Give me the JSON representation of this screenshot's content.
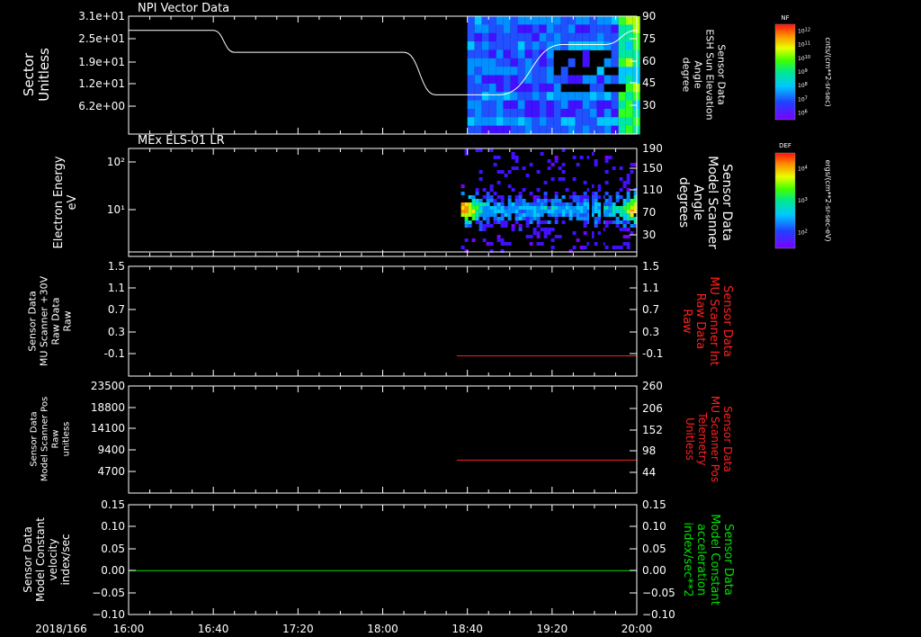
{
  "xaxis": {
    "date_label": "2018/166",
    "ticks": [
      "16:00",
      "16:40",
      "17:20",
      "18:00",
      "18:40",
      "19:20",
      "20:00"
    ]
  },
  "colors": {
    "background": "#000000",
    "axes": "#ffffff",
    "red": "#ff2020",
    "green": "#00e000"
  },
  "chart_data": [
    {
      "type": "heatmap",
      "title": "NPI Vector Data",
      "ylabel_left": [
        "Sector",
        "Unitless"
      ],
      "yticks_left": [
        "3.1e+01",
        "2.5e+01",
        "1.9e+01",
        "1.2e+01",
        "6.2e+00"
      ],
      "ylabel_right": [
        "Sensor Data",
        "ESH Sun Elevation",
        "Angle",
        "degree"
      ],
      "yticks_right": [
        "90",
        "75",
        "60",
        "45",
        "30"
      ],
      "ylim_right": [
        15,
        90
      ],
      "line_series": {
        "name": "ESH Sun Elevation",
        "x": [
          "16:00",
          "16:40",
          "16:50",
          "18:10",
          "18:25",
          "18:55",
          "19:25",
          "19:45",
          "20:00"
        ],
        "y": [
          81,
          81,
          67,
          67,
          40,
          40,
          72,
          72,
          81
        ]
      },
      "spectrogram_x_range": [
        "18:40",
        "20:00"
      ],
      "colorbar": {
        "label": "NF",
        "units": "cnts/(cm**2-sr-sec)",
        "tick_base": "10",
        "tick_exps": [
          "12",
          "11",
          "10",
          "9",
          "8",
          "7",
          "6"
        ]
      }
    },
    {
      "type": "heatmap",
      "title": "MEx ELS-01 LR",
      "ylabel_left": [
        "Electron Energy",
        "eV"
      ],
      "yscale_left": "log",
      "yticks_left": [
        "10²",
        "10¹"
      ],
      "ylabel_right": [
        "Sensor Data",
        "Model Scanner",
        "Angle",
        "degrees"
      ],
      "yticks_right": [
        "190",
        "150",
        "110",
        "70",
        "30"
      ],
      "ylim_right": [
        0,
        190
      ],
      "line_series": {
        "name": "Model Scanner Angle",
        "x": [
          "16:00",
          "20:00"
        ],
        "y": [
          8,
          8
        ]
      },
      "spectrogram_x_range": [
        "18:37",
        "20:00"
      ],
      "colorbar": {
        "label": "DEF",
        "units": "ergs/(cm**2-sr-sec-eV)",
        "tick_base": "10",
        "tick_exps": [
          "4",
          "3",
          "2"
        ]
      }
    },
    {
      "type": "line",
      "ylabel_left": [
        "Sensor Data",
        "MU Scanner +30V",
        "Raw Data",
        "Raw"
      ],
      "yticks_left": [
        "1.5",
        "1.1",
        "0.7",
        "0.3",
        "-0.1"
      ],
      "ylabel_right": [
        "Sensor Data",
        "MU Scanner Int",
        "Raw Data",
        "Raw"
      ],
      "yticks_right": [
        "1.5",
        "1.1",
        "0.7",
        "0.3",
        "-0.1"
      ],
      "ylim": [
        -0.4,
        1.5
      ],
      "series": [
        {
          "x": [
            "18:35",
            "20:00"
          ],
          "values": [
            -0.05,
            -0.05
          ],
          "color": "#ff2020"
        }
      ]
    },
    {
      "type": "line",
      "ylabel_left": [
        "Sensor Data",
        "Model Scanner Pos",
        "Raw",
        "unitless"
      ],
      "yticks_left": [
        "23500",
        "18800",
        "14100",
        "9400",
        "4700"
      ],
      "ylabel_right": [
        "Sensor Data",
        "MU Scanner Pos",
        "Telemetry",
        "Unitless"
      ],
      "yticks_right": [
        "260",
        "206",
        "152",
        "98",
        "44"
      ],
      "ylim_right": [
        0,
        260
      ],
      "series": [
        {
          "x": [
            "18:35",
            "20:00"
          ],
          "values": [
            80,
            80
          ],
          "color": "#ff2020"
        }
      ]
    },
    {
      "type": "line",
      "ylabel_left": [
        "Sensor Data",
        "Model Constant",
        "velocity",
        "index/sec"
      ],
      "yticks_left": [
        "0.15",
        "0.10",
        "0.05",
        "0.00",
        "−0.05",
        "−0.10"
      ],
      "ylabel_right": [
        "Sensor Data",
        "Model Constant",
        "acceleration",
        "index/sec**2"
      ],
      "yticks_right": [
        "0.15",
        "0.10",
        "0.05",
        "0.00",
        "−0.05",
        "−0.10"
      ],
      "ylim": [
        -0.1,
        0.15
      ],
      "series": [
        {
          "x": [
            "16:00",
            "20:00"
          ],
          "values": [
            0,
            0
          ],
          "color": "#00e000"
        }
      ]
    }
  ]
}
